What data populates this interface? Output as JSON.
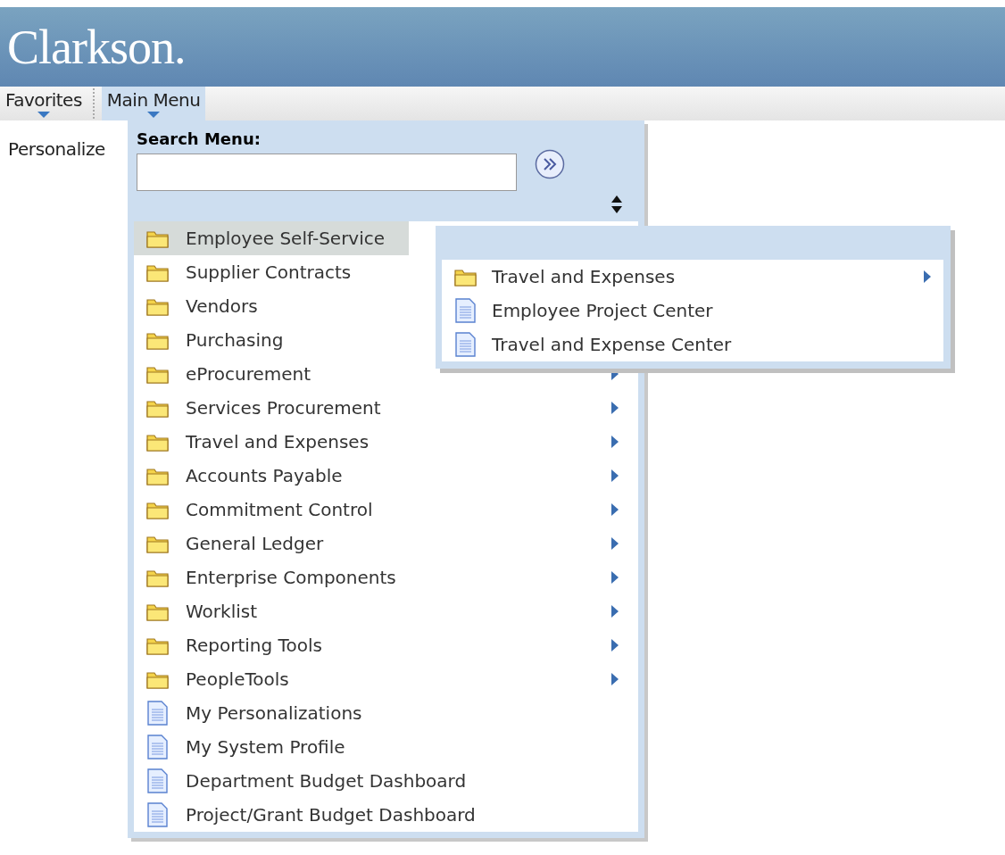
{
  "header": {
    "logo": "Clarkson."
  },
  "nav": [
    {
      "label": "Favorites",
      "selected": false
    },
    {
      "label": "Main Menu",
      "selected": true
    }
  ],
  "personalize": "Personalize",
  "search": {
    "label": "Search Menu:"
  },
  "menu": [
    {
      "label": "Employee Self-Service",
      "kind": "folder",
      "selected": true,
      "arrow": false
    },
    {
      "label": "Supplier Contracts",
      "kind": "folder",
      "selected": false,
      "arrow": false
    },
    {
      "label": "Vendors",
      "kind": "folder",
      "selected": false,
      "arrow": false
    },
    {
      "label": "Purchasing",
      "kind": "folder",
      "selected": false,
      "arrow": false
    },
    {
      "label": "eProcurement",
      "kind": "folder",
      "selected": false,
      "arrow": true
    },
    {
      "label": "Services Procurement",
      "kind": "folder",
      "selected": false,
      "arrow": true
    },
    {
      "label": "Travel and Expenses",
      "kind": "folder",
      "selected": false,
      "arrow": true
    },
    {
      "label": "Accounts Payable",
      "kind": "folder",
      "selected": false,
      "arrow": true
    },
    {
      "label": "Commitment Control",
      "kind": "folder",
      "selected": false,
      "arrow": true
    },
    {
      "label": "General Ledger",
      "kind": "folder",
      "selected": false,
      "arrow": true
    },
    {
      "label": "Enterprise Components",
      "kind": "folder",
      "selected": false,
      "arrow": true
    },
    {
      "label": "Worklist",
      "kind": "folder",
      "selected": false,
      "arrow": true
    },
    {
      "label": "Reporting Tools",
      "kind": "folder",
      "selected": false,
      "arrow": true
    },
    {
      "label": "PeopleTools",
      "kind": "folder",
      "selected": false,
      "arrow": true
    },
    {
      "label": "My Personalizations",
      "kind": "page",
      "selected": false,
      "arrow": false
    },
    {
      "label": "My System Profile",
      "kind": "page",
      "selected": false,
      "arrow": false
    },
    {
      "label": "Department Budget Dashboard",
      "kind": "page",
      "selected": false,
      "arrow": false
    },
    {
      "label": "Project/Grant Budget Dashboard",
      "kind": "page",
      "selected": false,
      "arrow": false
    }
  ],
  "submenu": [
    {
      "label": "Travel and Expenses",
      "kind": "folder",
      "arrow": true
    },
    {
      "label": "Employee Project Center",
      "kind": "page",
      "arrow": false
    },
    {
      "label": "Travel and Expense Center",
      "kind": "page",
      "arrow": false
    }
  ]
}
